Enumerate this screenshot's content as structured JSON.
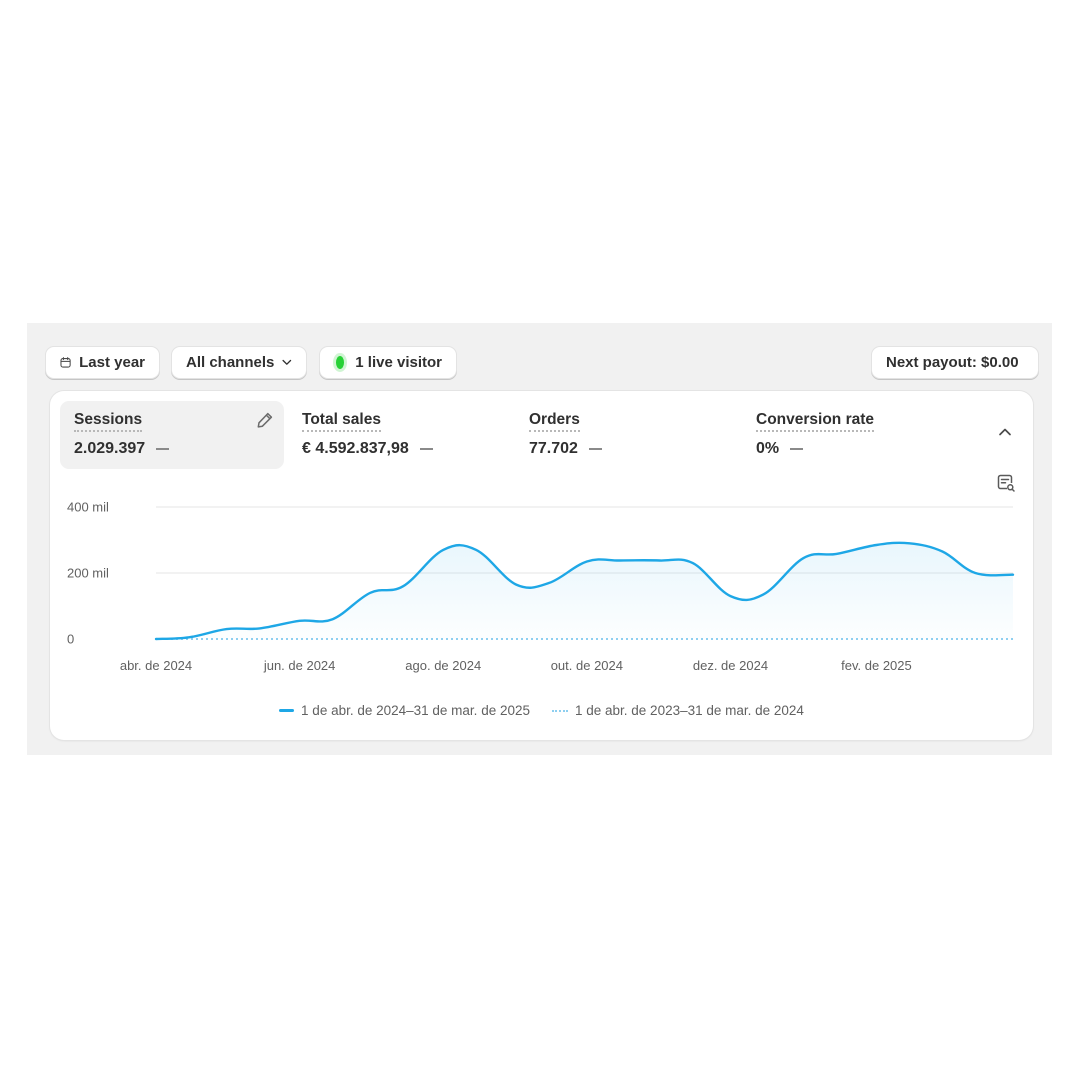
{
  "toolbar": {
    "date_range": "Last year",
    "channels": "All channels",
    "live_visitors": "1 live visitor",
    "payout": "Next payout: $0.00"
  },
  "metrics": [
    {
      "label": "Sessions",
      "value": "2.029.397"
    },
    {
      "label": "Total sales",
      "value": "€ 4.592.837,98"
    },
    {
      "label": "Orders",
      "value": "77.702"
    },
    {
      "label": "Conversion rate",
      "value": "0%"
    }
  ],
  "colors": {
    "current_series": "#1ea7e6",
    "previous_series": "#8ecff0",
    "live_dot": "#27d136"
  },
  "chart_data": {
    "type": "line",
    "y_ticks": [
      {
        "value": 400000,
        "label": "400 mil"
      },
      {
        "value": 200000,
        "label": "200 mil"
      },
      {
        "value": 0,
        "label": "0"
      }
    ],
    "ylim": [
      0,
      400000
    ],
    "x_ticks": [
      "abr. de 2024",
      "jun. de 2024",
      "ago. de 2024",
      "out. de 2024",
      "dez. de 2024",
      "fev. de 2025"
    ],
    "grid": true,
    "legend": "bottom",
    "series": [
      {
        "name": "1 de abr. de 2024–31 de mar. de 2025",
        "style": "solid",
        "x": [
          "2024-04-01",
          "2024-04-15",
          "2024-05-01",
          "2024-05-15",
          "2024-06-01",
          "2024-06-15",
          "2024-07-01",
          "2024-07-15",
          "2024-08-01",
          "2024-08-15",
          "2024-09-01",
          "2024-09-15",
          "2024-10-01",
          "2024-10-15",
          "2024-11-01",
          "2024-11-15",
          "2024-12-01",
          "2024-12-15",
          "2025-01-01",
          "2025-01-15",
          "2025-02-01",
          "2025-02-15",
          "2025-03-01",
          "2025-03-15",
          "2025-03-31"
        ],
        "y": [
          0,
          5000,
          30000,
          32000,
          55000,
          60000,
          140000,
          160000,
          270000,
          270000,
          165000,
          170000,
          235000,
          238000,
          238000,
          230000,
          130000,
          135000,
          245000,
          258000,
          285000,
          290000,
          265000,
          200000,
          195000
        ]
      },
      {
        "name": "1 de abr. de 2023–31 de mar. de 2024",
        "style": "dotted",
        "x": [
          "2024-04-01",
          "2025-03-31"
        ],
        "y": [
          0,
          0
        ]
      }
    ]
  }
}
